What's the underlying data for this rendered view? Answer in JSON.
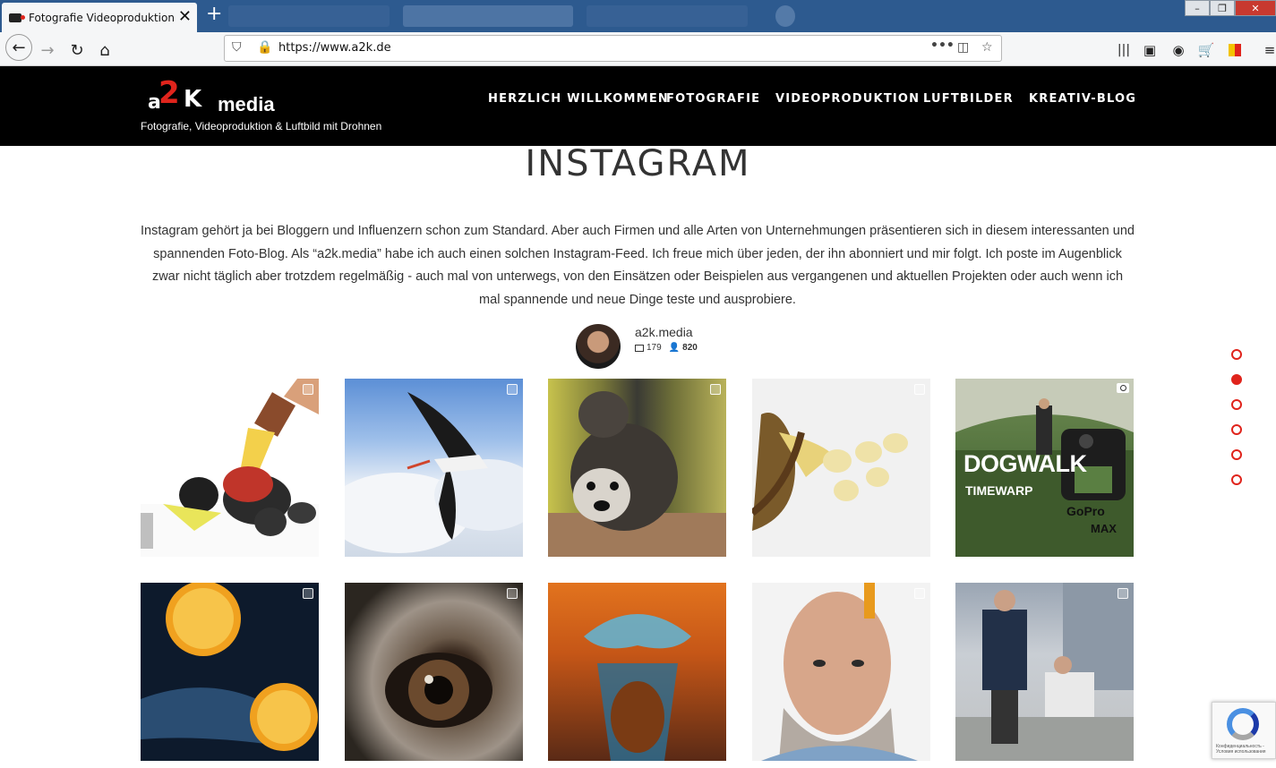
{
  "browser": {
    "tab_title": "Fotografie Videoproduktion Lu",
    "url": "https://www.a2k.de",
    "window_buttons": {
      "minimize": "–",
      "restore": "❐",
      "close": "✕"
    }
  },
  "site": {
    "logo": {
      "a": "a",
      "two": "2",
      "k": "K",
      "media": "media"
    },
    "tagline": "Fotografie, Videoproduktion & Luftbild mit Drohnen",
    "nav": [
      "HERZLICH WILLKOMMEN",
      "FOTOGRAFIE",
      "VIDEOPRODUKTION",
      "LUFTBILDER",
      "KREATIV-BLOG"
    ]
  },
  "content": {
    "heading": "INSTAGRAM",
    "intro": "Instagram gehört ja bei Bloggern und Influenzern schon zum Standard. Aber auch Firmen und alle Arten von Unternehmungen präsentieren sich in diesem interessanten und spannenden Foto-Blog. Als “a2k.media” habe ich auch einen solchen Instagram-Feed. Ich freue mich über jeden, der ihn abonniert und mir folgt. Ich poste im Augenblick zwar nicht täglich aber trotzdem regelmäßig - auch mal von unterwegs, von den Einsätzen oder Beispielen aus vergangenen und aktuellen Projekten oder auch wenn ich mal spannende und neue Dinge teste und ausprobiere."
  },
  "instagram": {
    "username": "a2k.media",
    "posts_count": "179",
    "followers_count": "820",
    "post5_text": {
      "title": "DOGWALK",
      "subtitle": "TIMEWARP",
      "brand": "GoPro",
      "model": "MAX"
    }
  },
  "section_dots": {
    "count": 6,
    "active_index": 1
  },
  "recaptcha": {
    "text": "Конфиденциальность - Условия использования"
  },
  "colors": {
    "accent": "#e0241c",
    "header_bg": "#000000",
    "text": "#333333"
  }
}
